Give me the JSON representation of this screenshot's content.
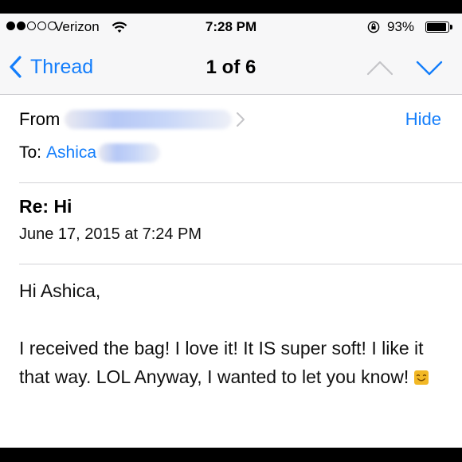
{
  "status": {
    "signal_bars": 5,
    "signal_filled": 2,
    "carrier": "Verizon",
    "time": "7:28 PM",
    "battery_text": "93%",
    "battery_level": 0.93
  },
  "nav": {
    "back_label": "Thread",
    "position": "1 of 6"
  },
  "header": {
    "from_label": "From",
    "hide_label": "Hide",
    "to_label": "To:",
    "to_name": "Ashica",
    "subject": "Re: Hi",
    "date": "June 17, 2015 at 7:24 PM"
  },
  "message": {
    "greeting": "Hi Ashica,",
    "paragraph": "I received the bag!  I love it!  It IS super soft!  I like it that way. LOL  Anyway, I wanted to let you know!"
  },
  "colors": {
    "accent": "#147efb",
    "separator": "#d3d3d6",
    "emoji": "#f2b825"
  },
  "icons": {
    "wifi": "wifi-icon",
    "rotation_lock": "rotation-lock-icon",
    "battery": "battery-icon",
    "back": "chevron-left-icon",
    "previous": "chevron-up-icon",
    "next": "chevron-down-icon",
    "sender_details": "chevron-right-icon",
    "emoji": "smiling-face-icon"
  }
}
